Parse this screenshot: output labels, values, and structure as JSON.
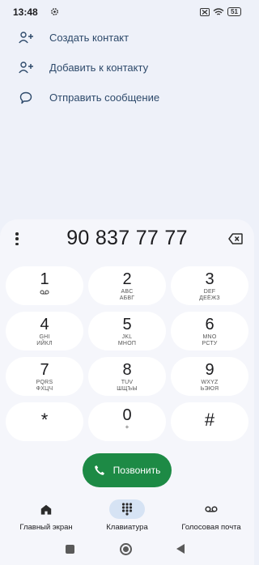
{
  "status_bar": {
    "time": "13:48",
    "battery": "51"
  },
  "actions": [
    {
      "label": "Создать контакт",
      "icon": "add-person-icon"
    },
    {
      "label": "Добавить к контакту",
      "icon": "add-person-icon"
    },
    {
      "label": "Отправить сообщение",
      "icon": "message-icon"
    }
  ],
  "dialer": {
    "number": "90 837 77 77",
    "keys": [
      {
        "digit": "1",
        "l1": "",
        "l2": ""
      },
      {
        "digit": "2",
        "l1": "ABC",
        "l2": "АБВГ"
      },
      {
        "digit": "3",
        "l1": "DEF",
        "l2": "ДЕЁЖЗ"
      },
      {
        "digit": "4",
        "l1": "GHI",
        "l2": "ИЙКЛ"
      },
      {
        "digit": "5",
        "l1": "JKL",
        "l2": "МНОП"
      },
      {
        "digit": "6",
        "l1": "MNO",
        "l2": "РСТУ"
      },
      {
        "digit": "7",
        "l1": "PQRS",
        "l2": "ФХЦЧ"
      },
      {
        "digit": "8",
        "l1": "TUV",
        "l2": "ШЩЪЫ"
      },
      {
        "digit": "9",
        "l1": "WXYZ",
        "l2": "ЬЭЮЯ"
      },
      {
        "digit": "*",
        "l1": "",
        "l2": ""
      },
      {
        "digit": "0",
        "l1": "+",
        "l2": ""
      },
      {
        "digit": "#",
        "l1": "",
        "l2": ""
      }
    ],
    "call_label": "Позвонить"
  },
  "nav": {
    "items": [
      {
        "label": "Главный экран",
        "icon": "home-icon"
      },
      {
        "label": "Клавиатура",
        "icon": "dialpad-icon",
        "active": true
      },
      {
        "label": "Голосовая почта",
        "icon": "voicemail-icon"
      }
    ]
  },
  "colors": {
    "background": "#eef1f9",
    "panel": "#f5f6fb",
    "call": "#1d8a45",
    "active_pill": "#d6e3f4",
    "action_text": "#2e4a6b"
  }
}
